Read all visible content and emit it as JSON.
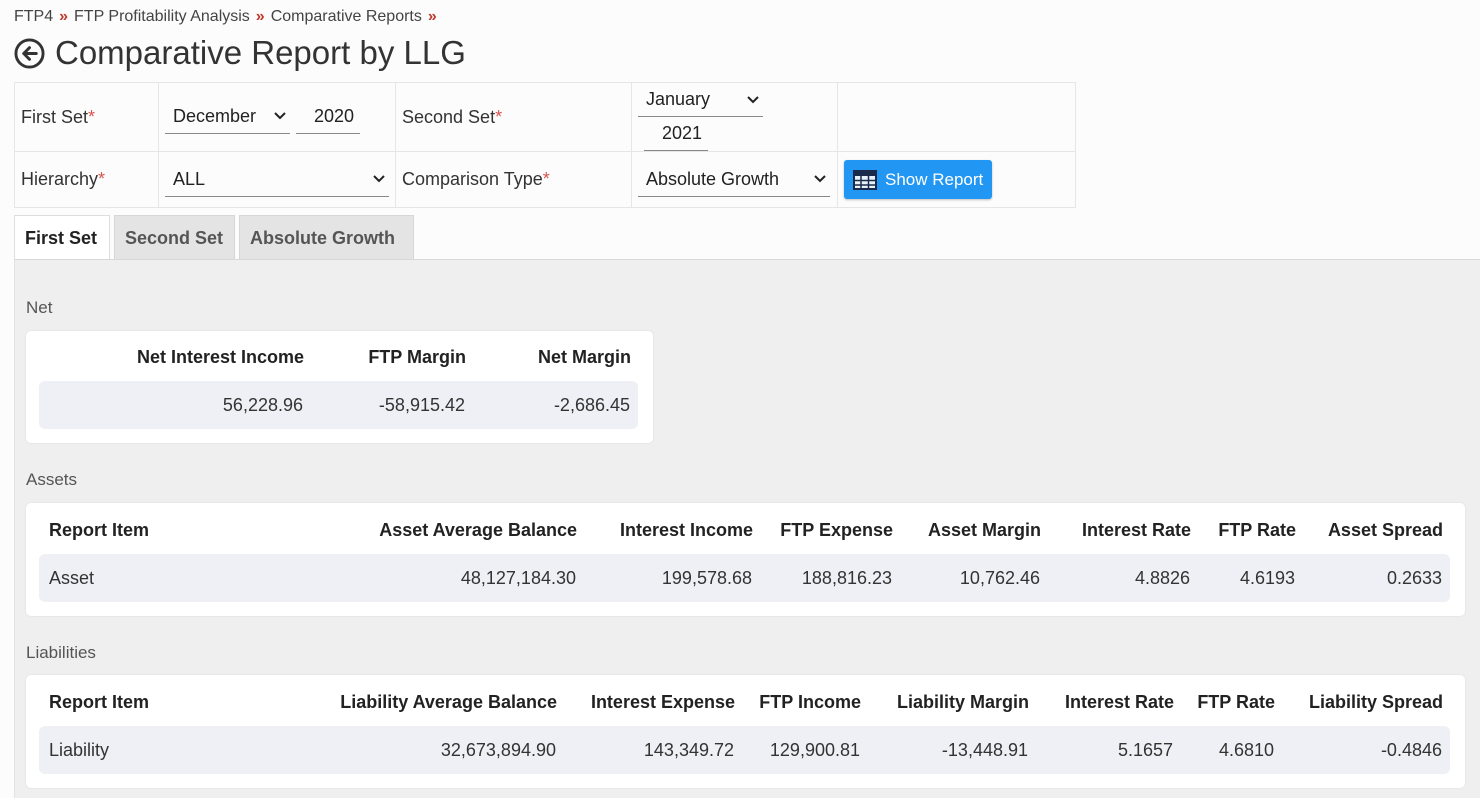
{
  "breadcrumb": [
    "FTP4",
    "FTP Profitability Analysis",
    "Comparative Reports"
  ],
  "page_title": "Comparative Report by LLG",
  "form": {
    "first_set_label": "First Set",
    "first_set_month": "December",
    "first_set_year": "2020",
    "second_set_label": "Second Set",
    "second_set_month": "January",
    "second_set_year": "2021",
    "hierarchy_label": "Hierarchy",
    "hierarchy_value": "ALL",
    "comparison_type_label": "Comparison Type",
    "comparison_type_value": "Absolute Growth",
    "required_mark": "*",
    "show_report_label": "Show Report"
  },
  "tabs": [
    "First Set",
    "Second Set",
    "Absolute Growth"
  ],
  "active_tab": "First Set",
  "net": {
    "label": "Net",
    "headers": [
      "Net Interest Income",
      "FTP Margin",
      "Net Margin"
    ],
    "values": [
      "56,228.96",
      "-58,915.42",
      "-2,686.45"
    ]
  },
  "assets": {
    "label": "Assets",
    "headers": [
      "Report Item",
      "Asset Average Balance",
      "Interest Income",
      "FTP Expense",
      "Asset Margin",
      "Interest Rate",
      "FTP Rate",
      "Asset Spread"
    ],
    "row": [
      "Asset",
      "48,127,184.30",
      "199,578.68",
      "188,816.23",
      "10,762.46",
      "4.8826",
      "4.6193",
      "0.2633"
    ]
  },
  "liabilities": {
    "label": "Liabilities",
    "headers": [
      "Report Item",
      "Liability Average Balance",
      "Interest Expense",
      "FTP Income",
      "Liability Margin",
      "Interest Rate",
      "FTP Rate",
      "Liability Spread"
    ],
    "row": [
      "Liability",
      "32,673,894.90",
      "143,349.72",
      "129,900.81",
      "-13,448.91",
      "5.1657",
      "4.6810",
      "-0.4846"
    ]
  },
  "colors": {
    "accent": "#2196f3",
    "breadcrumb_separator": "#c0392b",
    "required": "#d9534f",
    "row_background": "#eef0f5"
  }
}
